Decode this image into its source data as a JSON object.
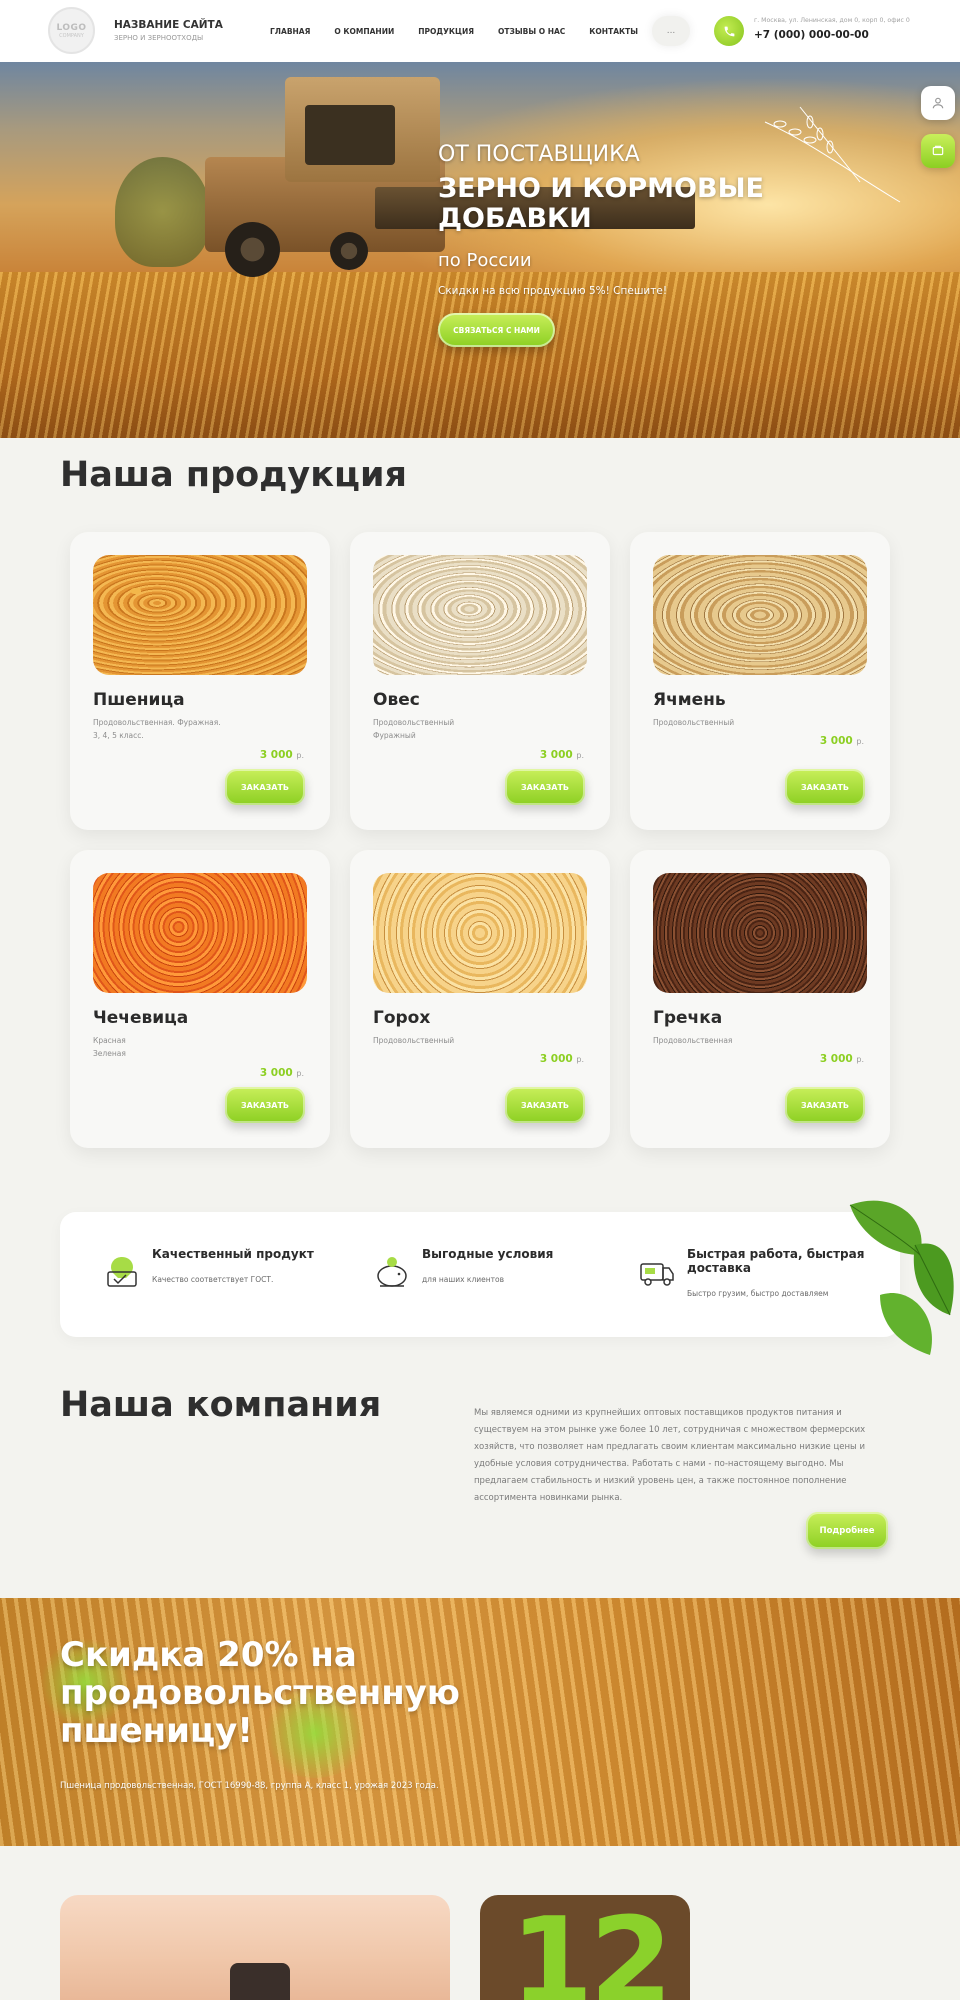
{
  "header": {
    "logo": {
      "line1": "LOGO",
      "line2": "COMPANY"
    },
    "site_title": "НАЗВАНИЕ САЙТА",
    "site_subtitle": "ЗЕРНО И ЗЕРНООТХОДЫ",
    "nav": [
      "ГЛАВНАЯ",
      "О КОМПАНИИ",
      "ПРОДУКЦИЯ",
      "ОТЗЫВЫ О НАС",
      "КОНТАКТЫ"
    ],
    "search_label": "...",
    "address": "г. Москва, ул. Ленинская, дом 0, корп 0, офис 0",
    "phone": "+7 (000) 000-00-00",
    "phone_icon": "phone-icon"
  },
  "hero": {
    "tag": "ОТ ПОСТАВЩИКА",
    "title": "ЗЕРНО И КОРМОВЫЕ ДОБАВКИ",
    "region": "по России",
    "promo": "Скидки на всю продукцию 5%! Спешите!",
    "cta": "СВЯЗАТЬСЯ С НАМИ"
  },
  "products": {
    "title": "Наша продукция",
    "order_label": "ЗАКАЗАТЬ",
    "currency": "р.",
    "items": [
      {
        "name": "Пшеница",
        "desc": "Продовольственная. Фуражная.\n3, 4, 5 класс.",
        "price": "3 000",
        "grain": "wheat"
      },
      {
        "name": "Овес",
        "desc": "Продовольственный\nФуражный",
        "price": "3 000",
        "grain": "oat"
      },
      {
        "name": "Ячмень",
        "desc": "Продовольственный",
        "price": "3 000",
        "grain": "barley"
      },
      {
        "name": "Чечевица",
        "desc": "Красная\nЗеленая",
        "price": "3 000",
        "grain": "lentil"
      },
      {
        "name": "Горох",
        "desc": "Продовольственный",
        "price": "3 000",
        "grain": "pea"
      },
      {
        "name": "Гречка",
        "desc": "Продовольственная",
        "price": "3 000",
        "grain": "buckwheat"
      }
    ]
  },
  "features": [
    {
      "title": "Качественный продукт",
      "desc": "Качество соответствует ГОСТ.",
      "icon": "quality-icon"
    },
    {
      "title": "Выгодные условия",
      "desc": "для наших клиентов",
      "icon": "piggy-bank-icon"
    },
    {
      "title": "Быстрая работа, быстрая доставка",
      "desc": "Быстро грузим, быстро доставляем",
      "icon": "delivery-truck-icon"
    }
  ],
  "company": {
    "title": "Наша компания",
    "text": "Мы являемся одними из крупнейших оптовых поставщиков продуктов питания и существуем на этом рынке уже более 10 лет, сотрудничая с множеством фермерских хозяйств, что позволяет нам предлагать своим клиентам максимально низкие цены и удобные условия сотрудничества. Работать с нами - по-настоящему выгодно. Мы предлагаем стабильность и низкий уровень цен, а также постоянное пополнение ассортимента новинками рынка.",
    "more": "Подробнее"
  },
  "promo": {
    "title": "Скидка 20% на продовольственную пшеницу!",
    "subtitle": "Пшеница продовольственная, ГОСТ 16990-88, группа А, класс 1, урожая 2023 года."
  },
  "bottom": {
    "number": "12"
  },
  "colors": {
    "accent": "#8ccf22",
    "accent_light": "#c9ef5b",
    "background": "#f3f3ef"
  }
}
